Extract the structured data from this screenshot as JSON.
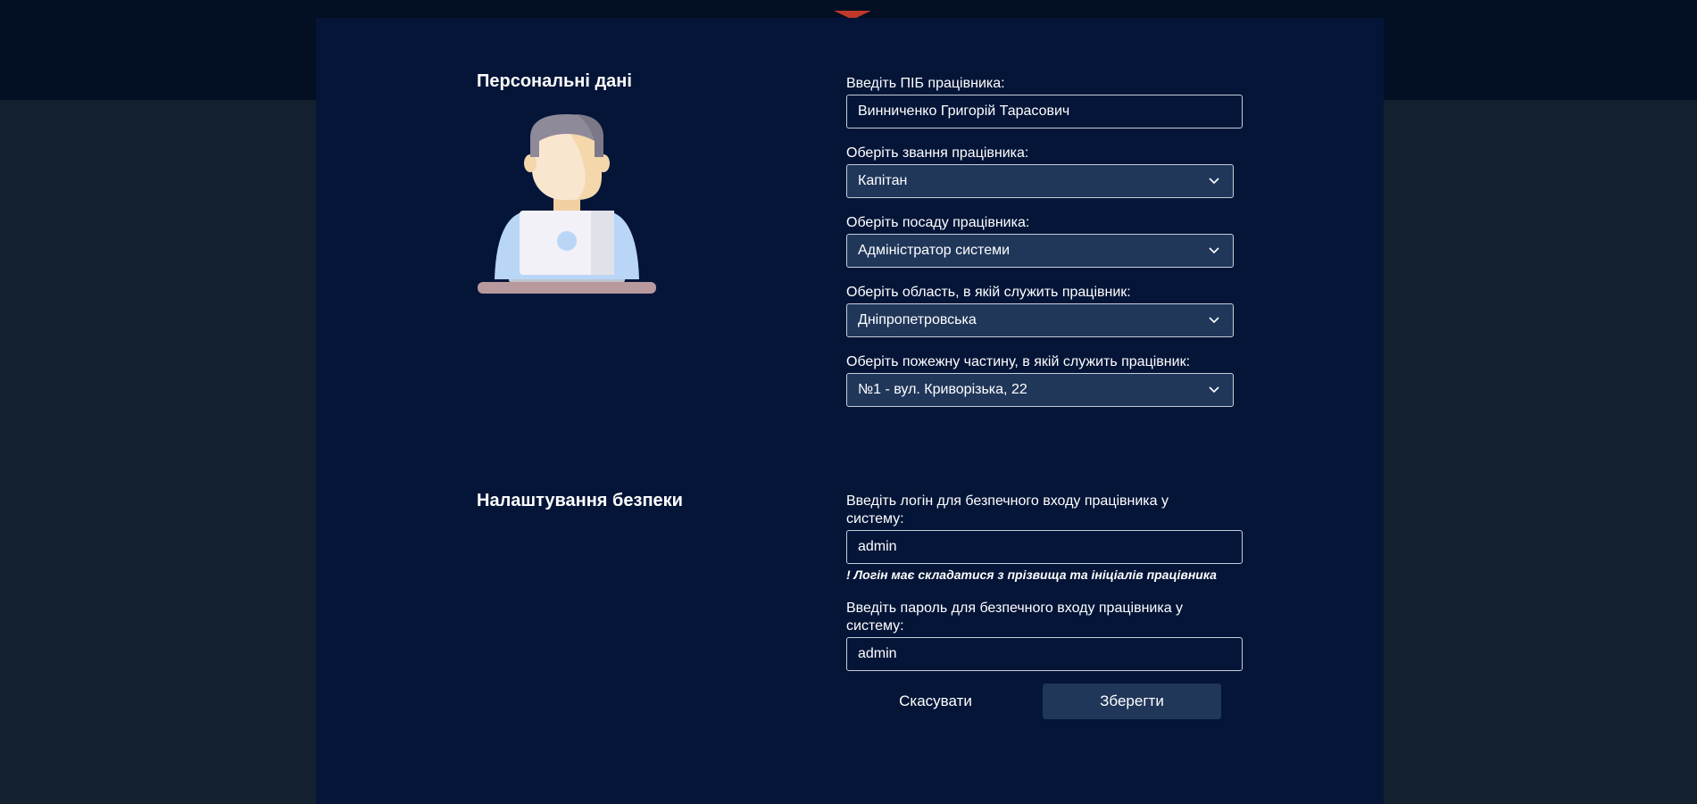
{
  "colors": {
    "page_background": "#13212f",
    "topbar": "#030f22",
    "panel": "#041538",
    "select_fill": "#20375a",
    "save_button": "#20375a",
    "text": "#ffffff"
  },
  "personal": {
    "title": "Персональні дані",
    "avatar_icon": "user-avatar-icon",
    "name_label": "Введіть ПІБ працівника:",
    "name_value": "Винниченко Григорій Тарасович",
    "rank_label": "Оберіть звання працівника:",
    "rank_value": "Капітан",
    "position_label": "Оберіть посаду працівника:",
    "position_value": "Адміністратор системи",
    "region_label": "Оберіть область, в якій служить працівник:",
    "region_value": "Дніпропетровська",
    "unit_label": "Оберіть пожежну частину, в якій служить працівник:",
    "unit_value": "№1 - вул. Криворізька, 22"
  },
  "security": {
    "title": "Налаштування безпеки",
    "login_label": "Введіть логін для безпечного входу працівника у систему:",
    "login_value": "admin",
    "login_hint": "! Логін має складатися з прізвища та ініціалів працівника",
    "password_label": "Введіть пароль для безпечного входу працівника у систему:",
    "password_value": "admin"
  },
  "actions": {
    "cancel_label": "Скасувати",
    "save_label": "Зберегти"
  }
}
